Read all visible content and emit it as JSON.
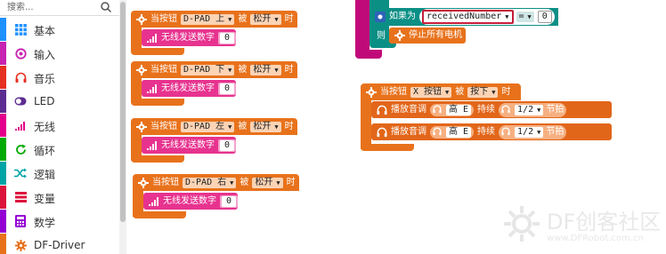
{
  "search": {
    "placeholder": "搜索..."
  },
  "categories": [
    {
      "label": "基本",
      "icon": "grid-icon",
      "color": "#1e90ff"
    },
    {
      "label": "输入",
      "icon": "circle-dot-icon",
      "color": "#c724b1"
    },
    {
      "label": "音乐",
      "icon": "headphones-icon",
      "color": "#e63022"
    },
    {
      "label": "LED",
      "icon": "toggle-icon",
      "color": "#5c2d91"
    },
    {
      "label": "无线",
      "icon": "signal-icon",
      "color": "#e3008c"
    },
    {
      "label": "循环",
      "icon": "refresh-icon",
      "color": "#00aa00"
    },
    {
      "label": "逻辑",
      "icon": "shuffle-icon",
      "color": "#00a4a6"
    },
    {
      "label": "变量",
      "icon": "list-icon",
      "color": "#dc143c"
    },
    {
      "label": "数学",
      "icon": "calculator-icon",
      "color": "#9400d3"
    },
    {
      "label": "DF-Driver",
      "icon": "gear-icon",
      "color": "#e8721c"
    }
  ],
  "blocks": {
    "hat_prefix": "当按钮",
    "hat_by": "被",
    "hat_time": "时",
    "send_label": "无线发送数字",
    "dpad": [
      {
        "button": "D-PAD 上",
        "action": "松开",
        "value": "0"
      },
      {
        "button": "D-PAD 下",
        "action": "松开",
        "value": "0"
      },
      {
        "button": "D-PAD 左",
        "action": "松开",
        "value": "0"
      },
      {
        "button": "D-PAD 右",
        "action": "松开",
        "value": "0"
      }
    ],
    "if_block": {
      "if_label": "如果为",
      "variable": "receivedNumber",
      "operator": "=",
      "compare_value": "0",
      "then_label": "则",
      "stop_label": "停止所有电机"
    },
    "x_button": {
      "button": "X 按钮",
      "action": "按下",
      "play_label": "播放音调",
      "note": "高 E",
      "duration_label": "持续",
      "beat": "1/2",
      "beat_unit": "节拍"
    }
  },
  "watermark": {
    "title": "DF创客社区",
    "url": "www.DFRobot.com.cn"
  },
  "colors": {
    "event_orange": "#e8721c",
    "radio_magenta": "#e7338f",
    "logic_teal": "#0b8f85"
  }
}
